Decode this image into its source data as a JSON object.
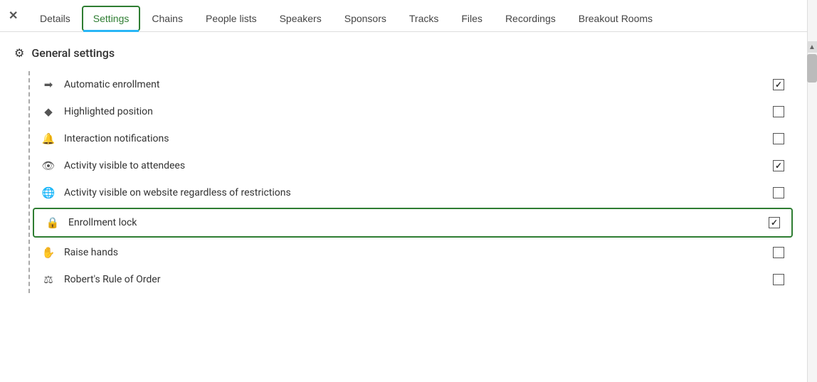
{
  "close_button": "✕",
  "nav": {
    "tabs": [
      {
        "id": "details",
        "label": "Details",
        "active": false
      },
      {
        "id": "settings",
        "label": "Settings",
        "active": true
      },
      {
        "id": "chains",
        "label": "Chains",
        "active": false
      },
      {
        "id": "people-lists",
        "label": "People lists",
        "active": false
      },
      {
        "id": "speakers",
        "label": "Speakers",
        "active": false
      },
      {
        "id": "sponsors",
        "label": "Sponsors",
        "active": false
      },
      {
        "id": "tracks",
        "label": "Tracks",
        "active": false
      },
      {
        "id": "files",
        "label": "Files",
        "active": false
      },
      {
        "id": "recordings",
        "label": "Recordings",
        "active": false
      },
      {
        "id": "breakout-rooms",
        "label": "Breakout Rooms",
        "active": false
      }
    ]
  },
  "section": {
    "title": "General settings",
    "gear_icon": "⚙"
  },
  "settings": [
    {
      "id": "automatic-enrollment",
      "label": "Automatic enrollment",
      "icon": "➡",
      "icon_name": "enrollment-icon",
      "checked": true,
      "highlighted": false
    },
    {
      "id": "highlighted-position",
      "label": "Highlighted position",
      "icon": "◆",
      "icon_name": "highlight-icon",
      "checked": false,
      "highlighted": false
    },
    {
      "id": "interaction-notifications",
      "label": "Interaction notifications",
      "icon": "🔔",
      "icon_name": "bell-icon",
      "checked": false,
      "highlighted": false
    },
    {
      "id": "activity-visible-attendees",
      "label": "Activity visible to attendees",
      "icon": "👁",
      "icon_name": "eye-icon",
      "checked": true,
      "highlighted": false
    },
    {
      "id": "activity-visible-website",
      "label": "Activity visible on website regardless of restrictions",
      "icon": "🌐",
      "icon_name": "globe-icon",
      "checked": false,
      "highlighted": false
    },
    {
      "id": "enrollment-lock",
      "label": "Enrollment lock",
      "icon": "🔒",
      "icon_name": "lock-icon",
      "checked": true,
      "highlighted": true
    },
    {
      "id": "raise-hands",
      "label": "Raise hands",
      "icon": "✋",
      "icon_name": "hand-icon",
      "checked": false,
      "highlighted": false
    },
    {
      "id": "roberts-rule",
      "label": "Robert's Rule of Order",
      "icon": "⚖",
      "icon_name": "scale-icon",
      "checked": false,
      "highlighted": false
    }
  ],
  "colors": {
    "active_tab_border": "#2e7d32",
    "active_tab_underline": "#29b6f6",
    "highlighted_row_border": "#2e7d32"
  }
}
